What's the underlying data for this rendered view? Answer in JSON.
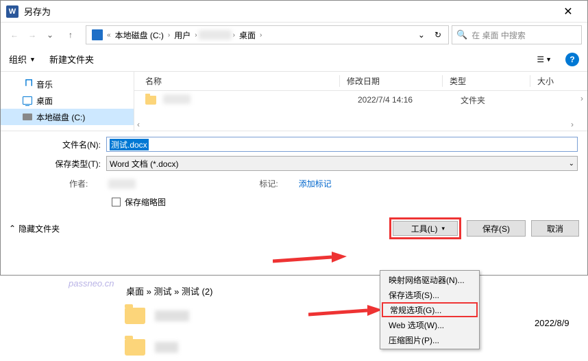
{
  "dialog": {
    "title": "另存为",
    "close_glyph": "✕"
  },
  "nav": {
    "sep_glyph": "›",
    "crumb_disk": "本地磁盘 (C:)",
    "crumb_user": "用户",
    "crumb_desktop": "桌面",
    "dropdown_glyph": "⌄",
    "refresh_glyph": "↻"
  },
  "search": {
    "placeholder": "在 桌面 中搜索",
    "icon_glyph": "🔍"
  },
  "toolbar": {
    "organize": "组织",
    "new_folder": "新建文件夹",
    "view_glyph": "☰",
    "help_glyph": "?"
  },
  "sidebar": {
    "items": [
      {
        "label": "音乐"
      },
      {
        "label": "桌面"
      },
      {
        "label": "本地磁盘 (C:)"
      }
    ]
  },
  "list": {
    "col_name": "名称",
    "col_date": "修改日期",
    "col_type": "类型",
    "col_size": "大小",
    "rows": [
      {
        "date": "2022/7/4 14:16",
        "type": "文件夹"
      }
    ]
  },
  "form": {
    "filename_label": "文件名(N):",
    "filename_value": "测试.docx",
    "savetype_label": "保存类型(T):",
    "savetype_value": "Word 文档 (*.docx)",
    "author_label": "作者:",
    "tag_label": "标记:",
    "tag_link": "添加标记",
    "thumb_label": "保存缩略图"
  },
  "footer": {
    "hide_folders": "隐藏文件夹",
    "tools": "工具(L)",
    "save": "保存(S)",
    "cancel": "取消",
    "caret_down": "▾",
    "caret_up": "⌃"
  },
  "dropdown": {
    "items": [
      "映射网络驱动器(N)...",
      "保存选项(S)...",
      "常规选项(G)...",
      "Web 选项(W)...",
      "压缩图片(P)..."
    ]
  },
  "background": {
    "breadcrumb_partial": "桌面 » 测试 » 测试 (2)",
    "date": "2022/8/9",
    "watermark": "passneo.cn"
  }
}
